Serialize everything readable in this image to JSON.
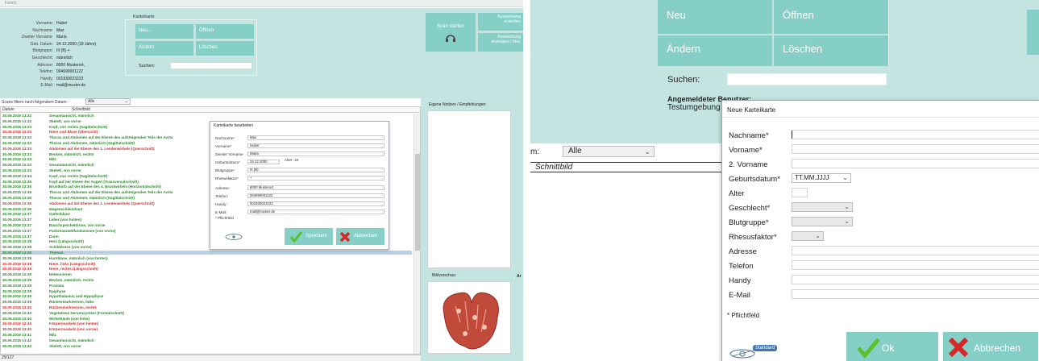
{
  "left_window": {
    "title": "Form1",
    "patient": {
      "fields": [
        {
          "label": "Vorname:",
          "value": "Huber"
        },
        {
          "label": "Nachname:",
          "value": "Max"
        },
        {
          "label": "Zweiter Vorname:",
          "value": "Maria"
        },
        {
          "label": "Geb. Datum:",
          "value": "24.12.2000    (18 Jahre)"
        },
        {
          "label": "Blutgruppe:",
          "value": "III (B) +"
        },
        {
          "label": "Geschlecht:",
          "value": "männlich"
        },
        {
          "label": "Adresse:",
          "value": "8000 Musterort,"
        },
        {
          "label": "Telefon:",
          "value": "004699001122"
        },
        {
          "label": "Handy:",
          "value": "001930023233"
        },
        {
          "label": "E-Mail:",
          "value": "mail@muster.de"
        }
      ]
    },
    "karteikarte": {
      "title": "Karteikarte",
      "neu": "Neu...",
      "oeffnen": "Öffnen",
      "aendern": "Ändern",
      "loeschen": "Löschen",
      "suchen_label": "Suchen:"
    },
    "scan_label": "Scan starten",
    "auswertung_erstellen": "Auswertung erstellen",
    "auswertung_anzeigen": "Auswertung anzeigen / lösc",
    "filter_label": "Scans filtern nach folgendem Datum:",
    "filter_value": "Alle",
    "col_datum": "Datum",
    "col_schnittbild": "Schnittbild",
    "notes_label": "Eigene Notizen / Empfehlungen:",
    "bildvorschau_label": "Bildvorschau:",
    "status": "29/127",
    "rows": [
      {
        "date": "30.09.2019 13:32",
        "text": "Gesamtansicht, männlich",
        "color": "#2a8a2a",
        "sel": false
      },
      {
        "date": "30.09.2019 13:32",
        "text": "Skelett, von vorne",
        "color": "#2a8a2a",
        "sel": false
      },
      {
        "date": "30.09.2019 13:33",
        "text": "Kopf, von rechts (Sagittalschnitt)",
        "color": "#2a8a2a",
        "sel": false
      },
      {
        "date": "30.09.2019 13:33",
        "text": "Niere und Blase (Übersicht)",
        "color": "#d23030",
        "sel": false
      },
      {
        "date": "30.09.2019 13:33",
        "text": "Thorax und Abdomen auf der Ebene des aufsteigenden Teils der Aorta",
        "color": "#2a8a2a",
        "sel": false
      },
      {
        "date": "30.09.2019 13:33",
        "text": "Thorax und Abdomen, männlich (Sagittalschnitt)",
        "color": "#2a8a2a",
        "sel": false
      },
      {
        "date": "30.09.2019 13:33",
        "text": "Abdomen auf der Ebene des 1. Lendenwirbels (Querschnitt)",
        "color": "#d23030",
        "sel": false
      },
      {
        "date": "30.09.2019 13:33",
        "text": "Becken, männlich, rechts",
        "color": "#2a8a2a",
        "sel": false
      },
      {
        "date": "30.09.2019 13:33",
        "text": "Milz",
        "color": "#2a8a2a",
        "sel": false
      },
      {
        "date": "30.09.2019 13:33",
        "text": "Gesamtansicht, männlich",
        "color": "#2a8a2a",
        "sel": false
      },
      {
        "date": "30.09.2019 13:33",
        "text": "Skelett, von vorne",
        "color": "#2a8a2a",
        "sel": false
      },
      {
        "date": "30.09.2019 13:34",
        "text": "Kopf, von rechts (Sagittalschnitt)",
        "color": "#2a8a2a",
        "sel": false
      },
      {
        "date": "30.09.2019 13:35",
        "text": "Kopf auf der Ebene der Augen (Transversalschnitt)",
        "color": "#2a8a2a",
        "sel": false
      },
      {
        "date": "30.09.2019 13:35",
        "text": "Brustkorb auf der Ebene des 4. Brustwirbels (Horizontalschnitt)",
        "color": "#2a8a2a",
        "sel": false
      },
      {
        "date": "30.09.2019 13:36",
        "text": "Thorax und Abdomen auf der Ebene des aufsteigenden Teils der Aorta",
        "color": "#2a8a2a",
        "sel": false
      },
      {
        "date": "30.09.2019 13:36",
        "text": "Thorax und Abdomen, männlich (Sagittalschnitt)",
        "color": "#2a8a2a",
        "sel": false
      },
      {
        "date": "30.09.2019 13:36",
        "text": "Abdomen auf der Ebene des 1. Lendenwirbels (Querschnitt)",
        "color": "#d23030",
        "sel": false
      },
      {
        "date": "30.09.2019 13:36",
        "text": "Magenschleimhaut",
        "color": "#2a8a2a",
        "sel": false
      },
      {
        "date": "30.09.2019 13:37",
        "text": "Gallenblase",
        "color": "#2a8a2a",
        "sel": false
      },
      {
        "date": "30.09.2019 13:37",
        "text": "Leber (von hinten)",
        "color": "#2a8a2a",
        "sel": false
      },
      {
        "date": "30.09.2019 13:37",
        "text": "Bauchspeicheldrüse, von vorne",
        "color": "#2a8a2a",
        "sel": false
      },
      {
        "date": "30.09.2019 13:37",
        "text": "Pankreaszwölfundanzone (von vorne)",
        "color": "#2a8a2a",
        "sel": false
      },
      {
        "date": "30.09.2019 13:37",
        "text": "Darm",
        "color": "#2a8a2a",
        "sel": false
      },
      {
        "date": "30.09.2019 13:38",
        "text": "Herz (Längsschnitt)",
        "color": "#2a8a2a",
        "sel": false
      },
      {
        "date": "30.09.2019 13:38",
        "text": "Schilddrüse (von vorne)",
        "color": "#2a8a2a",
        "sel": false
      },
      {
        "date": "30.09.2019 13:38",
        "text": "Thymus",
        "color": "#2a8a2a",
        "sel": true
      },
      {
        "date": "30.09.2019 13:38",
        "text": "Harnblase, männlich (von hinten)",
        "color": "#2a8a2a",
        "sel": false
      },
      {
        "date": "30.09.2019 13:38",
        "text": "Niere, links (Längsschnitt)",
        "color": "#d23030",
        "sel": false
      },
      {
        "date": "30.09.2019 13:39",
        "text": "Niere, rechts (Längsschnitt)",
        "color": "#d23030",
        "sel": false
      },
      {
        "date": "30.09.2019 13:39",
        "text": "Nebennieren",
        "color": "#2a8a2a",
        "sel": false
      },
      {
        "date": "30.09.2019 13:39",
        "text": "Becken, männlich, rechts",
        "color": "#2a8a2a",
        "sel": false
      },
      {
        "date": "30.09.2019 13:39",
        "text": "Prostata",
        "color": "#2a8a2a",
        "sel": false
      },
      {
        "date": "30.09.2019 13:39",
        "text": "Epiphyse",
        "color": "#2a8a2a",
        "sel": false
      },
      {
        "date": "30.09.2019 13:39",
        "text": "Hypothalamus und Hypophyse",
        "color": "#2a8a2a",
        "sel": false
      },
      {
        "date": "30.09.2019 13:39",
        "text": "Rückenmarknerven, links",
        "color": "#2a8a2a",
        "sel": false
      },
      {
        "date": "30.09.2019 13:40",
        "text": "Rückenmarknerven, rechts",
        "color": "#d23030",
        "sel": false
      },
      {
        "date": "30.09.2019 13:40",
        "text": "Vegetatives Nervensystem (Frontalschnitt)",
        "color": "#2a8a2a",
        "sel": false
      },
      {
        "date": "30.09.2019 13:40",
        "text": "Wirbelsäule (von links)",
        "color": "#2a8a2a",
        "sel": false
      },
      {
        "date": "30.09.2019 13:40",
        "text": "Körpermuskeln (von hinten)",
        "color": "#d23030",
        "sel": false
      },
      {
        "date": "30.09.2019 13:40",
        "text": "Körpermuskeln (von vorne)",
        "color": "#d23030",
        "sel": false
      },
      {
        "date": "30.09.2019 13:41",
        "text": "Milz",
        "color": "#2a8a2a",
        "sel": false
      },
      {
        "date": "30.09.2019 13:42",
        "text": "Gesamtansicht, männlich",
        "color": "#2a8a2a",
        "sel": false
      },
      {
        "date": "30.09.2019 13:42",
        "text": "Skelett, von vorne",
        "color": "#2a8a2a",
        "sel": false
      }
    ],
    "edit_dialog": {
      "title": "Karteikarte bearbeiten",
      "fields": [
        {
          "label": "Nachname*",
          "value": "Max"
        },
        {
          "label": "Vorname*",
          "value": "Huber"
        },
        {
          "label": "Zweiter Vorname",
          "value": "Maria"
        },
        {
          "label": "Geburtsdatum*",
          "value": "24.12.2000"
        },
        {
          "label": "Blutgruppe*",
          "value": "III (B)"
        },
        {
          "label": "Rhesusfaktor*",
          "value": "+"
        },
        {
          "label": "Adresse:",
          "value": "8000 Musterort,"
        },
        {
          "label": "Telefon:",
          "value": "004699001122"
        },
        {
          "label": "Handy:",
          "value": "001930023233"
        },
        {
          "label": "E-Mail:",
          "value": "mail@muster.de"
        }
      ],
      "alter_label": "Alter: 18",
      "pflicht": "* Pflichtfeld",
      "save": "Speichern",
      "cancel": "Abbrechen"
    }
  },
  "right_window": {
    "neu": "Neu",
    "oeffnen": "Öffnen",
    "aendern": "Ändern",
    "loeschen": "Löschen",
    "suchen_label": "Suchen:",
    "user_label": "Angemeldeter Benutzer:",
    "user_value": "Testumgebung",
    "filter_label": "m:",
    "filter_value": "Alle",
    "col_schnittbild": "Schnittbild",
    "dialog": {
      "title": "Neue Karteikarte",
      "nachname": "Nachname*",
      "vorname": "Vorname*",
      "vorname2": "2. Vorname",
      "geburtsdatum": "Geburtsdatum*",
      "date_placeholder": "TT.MM.JJJJ",
      "alter": "Alter",
      "geschlecht": "Geschlecht*",
      "blutgruppe": "Blutgruppe*",
      "rhesus": "Rhesusfaktor*",
      "adresse": "Adresse",
      "telefon": "Telefon",
      "handy": "Handy",
      "email": "E-Mail",
      "pflicht": "* Pflichtfeld",
      "standard": "Standard",
      "ok": "Ok",
      "cancel": "Abbrechen"
    }
  },
  "colors": {
    "teal_bg": "#c3e4e0",
    "teal_btn": "#85cfc7",
    "green_text": "#2a8a2a",
    "red_text": "#d23030",
    "check_green": "#5cc02c",
    "x_red": "#d62828",
    "selection": "#b9d0e6"
  }
}
